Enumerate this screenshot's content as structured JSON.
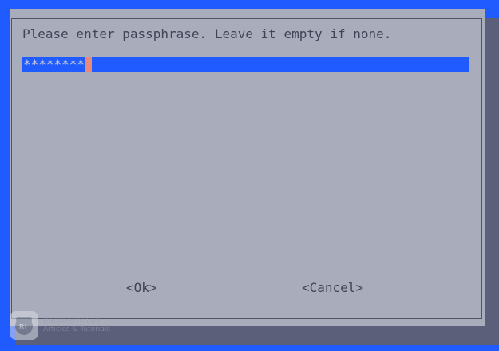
{
  "dialog": {
    "prompt": "Please enter passphrase. Leave it empty if none.",
    "input_value": "********",
    "ok_label": "<Ok>",
    "cancel_label": "<Cancel>"
  },
  "watermark": {
    "logo_text": "RL",
    "title": "Raspberry Lab",
    "subtitle": "Articles & Tutorials"
  },
  "colors": {
    "background": "#1f5bff",
    "dialog": "#a9acbb",
    "input_bar": "#1f5bff",
    "cursor": "#e88a7b",
    "text": "#3f4456"
  }
}
